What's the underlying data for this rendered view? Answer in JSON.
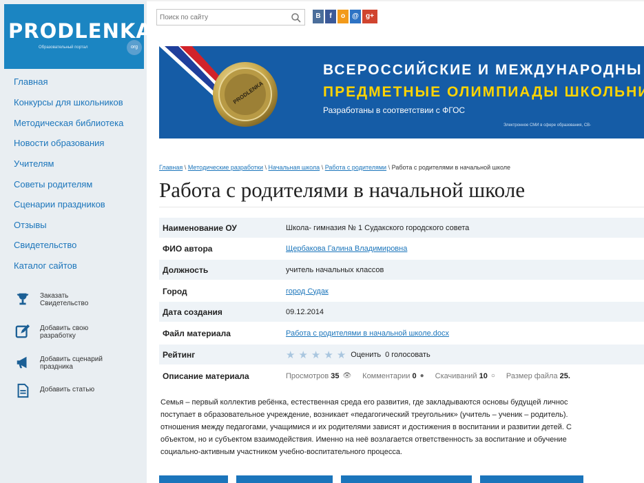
{
  "logo": {
    "text": "PRODLENKA",
    "subtitle": "Образовательный портал",
    "badge": "org"
  },
  "search": {
    "placeholder": "Поиск по сайту"
  },
  "social": [
    {
      "label": "В",
      "color": "#4b6e9b",
      "icon": "vk-icon"
    },
    {
      "label": "f",
      "color": "#3b5998",
      "icon": "facebook-icon"
    },
    {
      "label": "o",
      "color": "#f29a1a",
      "icon": "odnoklassniki-icon"
    },
    {
      "label": "@",
      "color": "#2d73c4",
      "icon": "mailru-icon"
    },
    {
      "label": "g+",
      "color": "#d0442f",
      "icon": "googleplus-icon"
    }
  ],
  "sidebar": {
    "nav": [
      "Главная",
      "Конкурсы для школьников",
      "Методическая библиотека",
      "Новости образования",
      "Учителям",
      "Советы родителям",
      "Сценарии праздников",
      "Отзывы",
      "Свидетельство",
      "Каталог сайтов"
    ],
    "actions": [
      {
        "label": "Заказать Свидетельство",
        "icon": "trophy-icon"
      },
      {
        "label": "Добавить свою разработку",
        "icon": "edit-icon"
      },
      {
        "label": "Добавить сценарий праздника",
        "icon": "megaphone-icon"
      },
      {
        "label": "Добавить статью",
        "icon": "document-icon"
      }
    ]
  },
  "banner": {
    "line1": "ВСЕРОССИЙСКИЕ И МЕЖДУНАРОДНЫ",
    "line2": "ПРЕДМЕТНЫЕ ОЛИМПИАДЫ ШКОЛЬНИ",
    "line3": "Разработаны в соответствии с ФГОС",
    "line4": "Электронное СМИ в сфере образования, СВ-",
    "medal_text": "PRODLENKA"
  },
  "breadcrumb": {
    "items": [
      "Главная",
      "Методические разработки",
      "Начальная школа",
      "Работа с родителями"
    ],
    "current": "Работа с родителями в начальной школе",
    "separator": "\\"
  },
  "page_title": "Работа с родителями в начальной школе",
  "info": {
    "org_label": "Наименование ОУ",
    "org_value": "Школа- гимназия № 1 Судакского городского совета",
    "author_label": "ФИО автора",
    "author_value": "Щербакова Галина Владимировна",
    "position_label": "Должность",
    "position_value": "учитель начальных классов",
    "city_label": "Город",
    "city_value": "город Судак",
    "date_label": "Дата создания",
    "date_value": "09.12.2014",
    "file_label": "Файл материала",
    "file_value": "Работа с родителями в начальной школе.docx",
    "rating_label": "Рейтинг",
    "rating_rate_text": "Оценить",
    "rating_votes_text": "0 голосовать",
    "rating_stars_filled": 0,
    "rating_stars_total": 5,
    "desc_label": "Описание материала",
    "views_label": "Просмотров",
    "views_value": "35",
    "comments_label": "Комментарии",
    "comments_value": "0",
    "downloads_label": "Скачиваний",
    "downloads_value": "10",
    "size_label": "Размер файла",
    "size_value": "25."
  },
  "description": [
    "Семья – первый коллектив ребёнка, естественная среда его развития, где закладываются основы будущей личнос",
    "поступает в образовательное учреждение, возникает «педагогический треугольник» (учитель – ученик – родитель).",
    "отношения между педагогами, учащимися и их родителями зависят и достижения в воспитании и развитии детей. С",
    "объектом, но и субъектом взаимодействия. Именно на неё возлагается ответственность за воспитание и обучение",
    "социально-активным участником учебно-воспитательного процесса."
  ],
  "colors": {
    "brand": "#1b85c2",
    "link": "#1b75bb",
    "banner_bg": "#1a63b0",
    "banner_accent": "#ffd400"
  }
}
